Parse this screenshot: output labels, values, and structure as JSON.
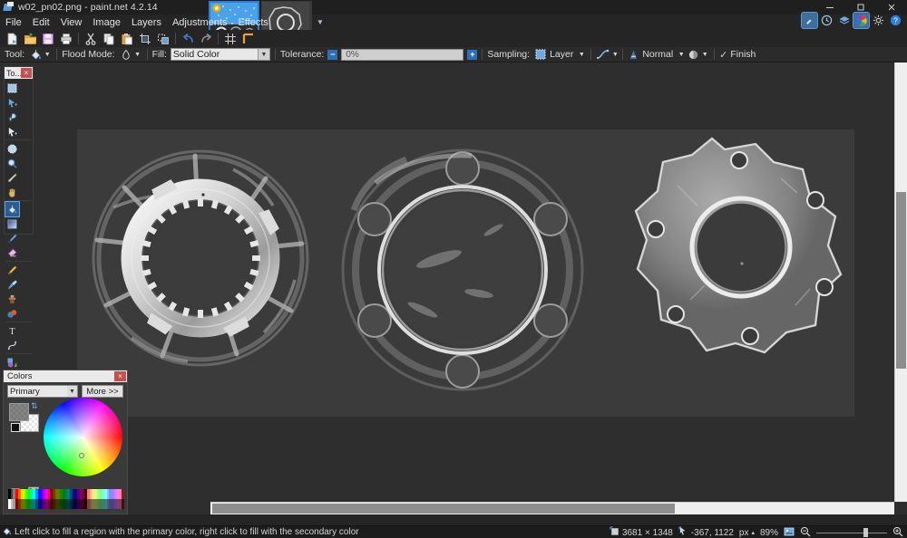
{
  "window": {
    "title": "w02_pn02.png - paint.net 4.2.14",
    "app_icon": "paintnet-icon",
    "minimize": "minimize-icon",
    "maximize": "maximize-icon",
    "close": "close-icon"
  },
  "menu": {
    "items": [
      {
        "label": "File"
      },
      {
        "label": "Edit"
      },
      {
        "label": "View"
      },
      {
        "label": "Image"
      },
      {
        "label": "Layers"
      },
      {
        "label": "Adjustments"
      },
      {
        "label": "Effects"
      }
    ]
  },
  "toolbar": {
    "buttons": [
      {
        "name": "new-icon",
        "glyph": "new"
      },
      {
        "name": "open-icon",
        "glyph": "open"
      },
      {
        "name": "save-icon",
        "glyph": "save"
      },
      {
        "name": "print-icon",
        "glyph": "print"
      },
      {
        "name": "cut-icon",
        "glyph": "cut"
      },
      {
        "name": "copy-icon",
        "glyph": "copy"
      },
      {
        "name": "paste-icon",
        "glyph": "paste"
      },
      {
        "name": "crop-to-selection-icon",
        "glyph": "crop"
      },
      {
        "name": "deselect-all-icon",
        "glyph": "deselect"
      },
      {
        "name": "undo-icon",
        "glyph": "undo"
      },
      {
        "name": "redo-icon",
        "glyph": "redo"
      },
      {
        "name": "pixel-grid-icon",
        "glyph": "grid"
      },
      {
        "name": "rulers-icon",
        "glyph": "rulers"
      }
    ]
  },
  "header_icons": [
    {
      "name": "tools-window-icon",
      "selected": true
    },
    {
      "name": "history-window-icon",
      "selected": false
    },
    {
      "name": "layers-window-icon",
      "selected": false
    },
    {
      "name": "colors-window-icon",
      "selected": true
    },
    {
      "name": "settings-icon",
      "selected": false
    },
    {
      "name": "help-icon",
      "selected": false
    }
  ],
  "thumbnails": [
    {
      "name": "image-thumbnail-active",
      "active": true
    },
    {
      "name": "image-thumbnail-2",
      "active": false
    }
  ],
  "options_bar": {
    "tool_label": "Tool:",
    "tool_icon": "paint-bucket-icon",
    "flood_mode_label": "Flood Mode:",
    "flood_mode_icon": "flood-local-icon",
    "fill_label": "Fill:",
    "fill_value": "Solid Color",
    "tolerance_label": "Tolerance:",
    "tolerance_value": "0%",
    "tolerance_minus": "−",
    "tolerance_plus": "+",
    "sampling_label": "Sampling:",
    "sampling_value": "Layer",
    "sampling_icon": "layer-icon",
    "antialiasing_icon": "antialiasing-icon",
    "blend_mode_value": "Normal",
    "blend_mode_icon": "blend-mode-icon",
    "alpha_blending_icon": "alpha-blending-icon",
    "finish_label": "Finish",
    "finish_check": "✓"
  },
  "tool_palette": {
    "caption": "To...",
    "close": "×",
    "tools": [
      {
        "name": "rectangle-select-tool",
        "selected": false
      },
      {
        "name": "move-selected-tool",
        "selected": false
      },
      {
        "name": "lasso-select-tool",
        "selected": false
      },
      {
        "name": "move-selection-tool",
        "selected": false
      },
      {
        "name": "ellipse-select-tool",
        "selected": false
      },
      {
        "name": "zoom-tool",
        "selected": false
      },
      {
        "name": "magic-wand-tool",
        "selected": false
      },
      {
        "name": "pan-tool",
        "selected": false
      },
      {
        "name": "paint-bucket-tool",
        "selected": true
      },
      {
        "name": "gradient-tool",
        "selected": false
      },
      {
        "name": "paintbrush-tool",
        "selected": false
      },
      {
        "name": "eraser-tool",
        "selected": false
      },
      {
        "name": "pencil-tool",
        "selected": false
      },
      {
        "name": "color-picker-tool",
        "selected": false
      },
      {
        "name": "clone-stamp-tool",
        "selected": false
      },
      {
        "name": "recolor-tool",
        "selected": false
      },
      {
        "name": "text-tool",
        "selected": false
      },
      {
        "name": "line-curve-tool",
        "selected": false
      },
      {
        "name": "shapes-tool",
        "selected": false
      }
    ]
  },
  "colors_panel": {
    "caption": "Colors",
    "close": "×",
    "mode_value": "Primary",
    "more_label": "More >>",
    "primary_swatch": "#6e6e6e",
    "secondary_swatch": "#ffffff",
    "swap_icon": "swap-colors-icon",
    "reset_icon": "reset-colors-icon",
    "add_palette_icon": "add-to-palette-icon",
    "palette_icon": "palette-icon",
    "palette_dropdown_icon": "chevron-down-icon",
    "palette_row1": [
      "#000000",
      "#404040",
      "#808080",
      "#ff0000",
      "#ff6a00",
      "#ffd800",
      "#b6ff00",
      "#4cff00",
      "#00ff21",
      "#00ff90",
      "#00ffff",
      "#0094ff",
      "#0026ff",
      "#4800ff",
      "#b200ff",
      "#ff00dc",
      "#ff006e",
      "#7f0000",
      "#7f3300",
      "#7f6a00",
      "#5b7f00",
      "#267f00",
      "#007f0e",
      "#007f46",
      "#007f7f",
      "#004a7f",
      "#00137f",
      "#21007f",
      "#57007f",
      "#7f006e",
      "#7f0037",
      "#3f0000",
      "#ff7f7f",
      "#ffb27f",
      "#ffe97f",
      "#dbff7f",
      "#a5ff7f",
      "#7fff8e",
      "#7fffc4",
      "#7fffff",
      "#7fc9ff",
      "#7f8eff",
      "#a17fff",
      "#d67fff",
      "#ff7fed",
      "#ff7fb2",
      "#7f1f1f"
    ],
    "palette_row2": [
      "#ffffff",
      "#c0c0c0",
      "#a0a0a0",
      "#7f0000",
      "#7f3300",
      "#7f6a00",
      "#5b7f00",
      "#267f00",
      "#007f0e",
      "#007f46",
      "#007f7f",
      "#004a7f",
      "#00137f",
      "#21007f",
      "#57007f",
      "#7f006e",
      "#7f0037",
      "#3f0000",
      "#3f1a00",
      "#3f3500",
      "#2d3f00",
      "#133f00",
      "#003f07",
      "#003f23",
      "#003f3f",
      "#00253f",
      "#00093f",
      "#10003f",
      "#2b003f",
      "#3f0037",
      "#3f001b",
      "#1f0000",
      "#7f3f3f",
      "#7f593f",
      "#7f743f",
      "#6d7f3f",
      "#527f3f",
      "#3f7f47",
      "#3f7f62",
      "#3f7f7f",
      "#3f647f",
      "#3f477f",
      "#503f7f",
      "#6b3f7f",
      "#7f3f76",
      "#7f3f59",
      "#3f0f0f"
    ]
  },
  "canvas": {
    "image_background": "#3b3b3b",
    "parts": [
      {
        "name": "splined-synchro-ring"
      },
      {
        "name": "bearing-cage-ring"
      },
      {
        "name": "six-lobe-flange-plate"
      }
    ]
  },
  "status_bar": {
    "hint_icon": "paint-bucket-icon",
    "hint_text": "Left click to fill a region with the primary color, right click to fill with the secondary color",
    "image_size_icon": "image-size-icon",
    "image_size": "3681 × 1348",
    "cursor_icon": "cursor-position-icon",
    "cursor_position": "-367, 1122",
    "units": "px",
    "units_caret": "▴",
    "zoom_level": "89%",
    "fit_icon": "zoom-to-fit-icon",
    "zoom_out_icon": "zoom-out-icon",
    "zoom_in_icon": "zoom-in-icon"
  }
}
